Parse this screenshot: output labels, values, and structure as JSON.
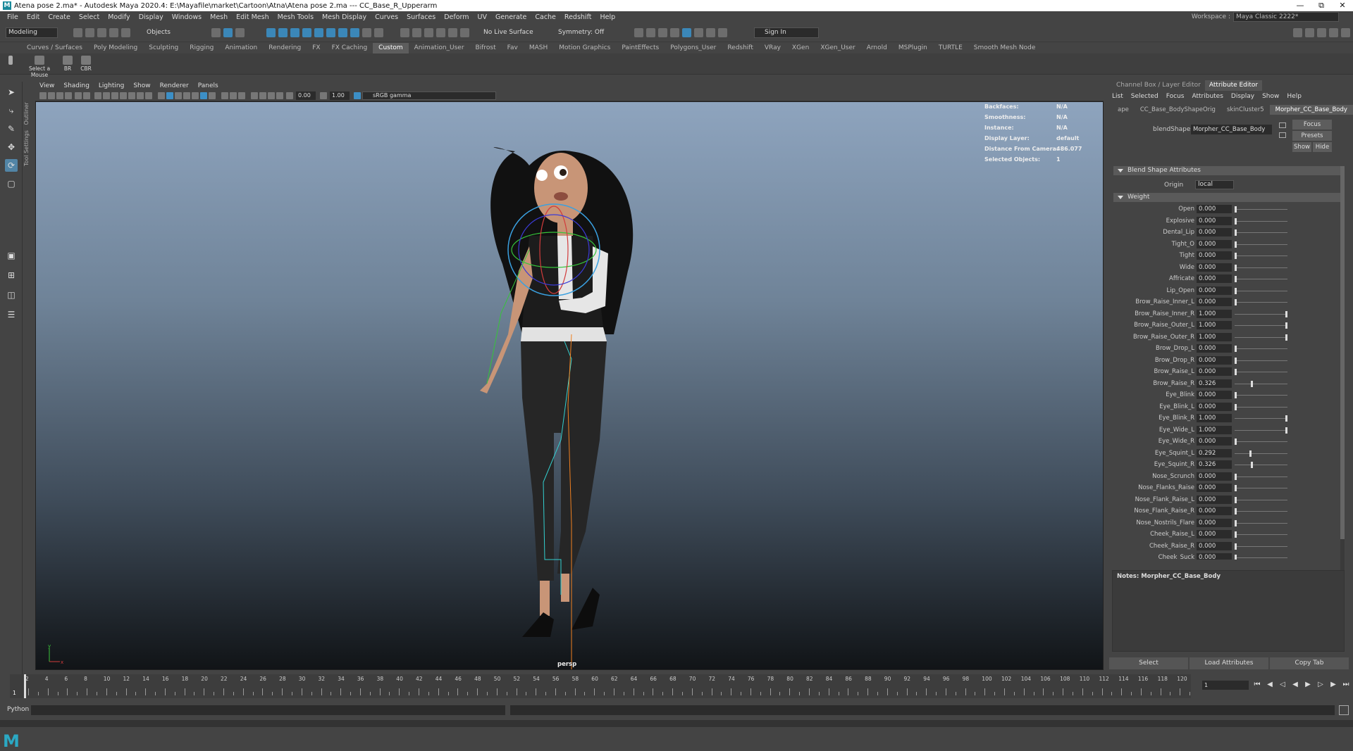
{
  "title": {
    "text": "Atena pose 2.ma* - Autodesk Maya 2020.4: E:\\Mayafile\\market\\Cartoon\\Atna\\Atena pose 2.ma  ---  CC_Base_R_Upperarm",
    "logo": "M"
  },
  "menu": [
    "File",
    "Edit",
    "Create",
    "Select",
    "Modify",
    "Display",
    "Windows",
    "Mesh",
    "Edit Mesh",
    "Mesh Tools",
    "Mesh Display",
    "Curves",
    "Surfaces",
    "Deform",
    "UV",
    "Generate",
    "Cache",
    "Redshift",
    "Help"
  ],
  "workspace": {
    "label": "Workspace :",
    "value": "Maya Classic 2222*"
  },
  "status": {
    "mode": "Modeling",
    "objects": "Objects",
    "live_surface": "No Live Surface",
    "symmetry": "Symmetry: Off",
    "sign_in": "Sign In"
  },
  "shelf_tabs": [
    "Curves / Surfaces",
    "Poly Modeling",
    "Sculpting",
    "Rigging",
    "Animation",
    "Rendering",
    "FX",
    "FX Caching",
    "Custom",
    "Animation_User",
    "Bifrost",
    "Fav",
    "MASH",
    "Motion Graphics",
    "PaintEffects",
    "Polygons_User",
    "Redshift",
    "VRay",
    "XGen",
    "XGen_User",
    "Arnold",
    "MSPlugin",
    "TURTLE",
    "Smooth Mesh Node"
  ],
  "shelf_active": "Custom",
  "shelf_buttons": [
    "Select a Mouse",
    "BR",
    "CBR"
  ],
  "side_labels": {
    "tool_settings": "Tool Settings",
    "outliner": "Outliner"
  },
  "panel_menu": [
    "View",
    "Shading",
    "Lighting",
    "Show",
    "Renderer",
    "Panels"
  ],
  "panel_toolbar": {
    "exposure": "0.00",
    "gamma": "1.00",
    "color_space": "sRGB gamma"
  },
  "hud": [
    {
      "k": "Backfaces:",
      "v": "N/A"
    },
    {
      "k": "Smoothness:",
      "v": "N/A"
    },
    {
      "k": "Instance:",
      "v": "N/A"
    },
    {
      "k": "Display Layer:",
      "v": "default"
    },
    {
      "k": "Distance From Camera:",
      "v": "486.077"
    },
    {
      "k": "Selected Objects:",
      "v": "1"
    }
  ],
  "camera": "persp",
  "right_tabs": [
    "Channel Box / Layer Editor",
    "Attribute Editor"
  ],
  "right_menu": [
    "List",
    "Selected",
    "Focus",
    "Attributes",
    "Display",
    "Show",
    "Help"
  ],
  "node_tabs": [
    "ape",
    "CC_Base_BodyShapeOrig",
    "skinCluster5",
    "Morpher_CC_Base_Body"
  ],
  "blendshape": {
    "label": "blendShape:",
    "value": "Morpher_CC_Base_Body"
  },
  "rbuttons": {
    "focus": "Focus",
    "presets": "Presets",
    "show": "Show",
    "hide": "Hide"
  },
  "sections": {
    "blend": "Blend Shape Attributes",
    "weight": "Weight"
  },
  "origin": {
    "label": "Origin",
    "value": "local"
  },
  "weights": [
    {
      "name": "Open",
      "value": "0.000",
      "v": 0
    },
    {
      "name": "Explosive",
      "value": "0.000",
      "v": 0
    },
    {
      "name": "Dental_Lip",
      "value": "0.000",
      "v": 0
    },
    {
      "name": "Tight_O",
      "value": "0.000",
      "v": 0
    },
    {
      "name": "Tight",
      "value": "0.000",
      "v": 0
    },
    {
      "name": "Wide",
      "value": "0.000",
      "v": 0
    },
    {
      "name": "Affricate",
      "value": "0.000",
      "v": 0
    },
    {
      "name": "Lip_Open",
      "value": "0.000",
      "v": 0
    },
    {
      "name": "Brow_Raise_Inner_L",
      "value": "0.000",
      "v": 0
    },
    {
      "name": "Brow_Raise_Inner_R",
      "value": "1.000",
      "v": 1
    },
    {
      "name": "Brow_Raise_Outer_L",
      "value": "1.000",
      "v": 1
    },
    {
      "name": "Brow_Raise_Outer_R",
      "value": "1.000",
      "v": 1
    },
    {
      "name": "Brow_Drop_L",
      "value": "0.000",
      "v": 0
    },
    {
      "name": "Brow_Drop_R",
      "value": "0.000",
      "v": 0
    },
    {
      "name": "Brow_Raise_L",
      "value": "0.000",
      "v": 0
    },
    {
      "name": "Brow_Raise_R",
      "value": "0.326",
      "v": 0.326
    },
    {
      "name": "Eye_Blink",
      "value": "0.000",
      "v": 0
    },
    {
      "name": "Eye_Blink_L",
      "value": "0.000",
      "v": 0
    },
    {
      "name": "Eye_Blink_R",
      "value": "1.000",
      "v": 1
    },
    {
      "name": "Eye_Wide_L",
      "value": "1.000",
      "v": 1
    },
    {
      "name": "Eye_Wide_R",
      "value": "0.000",
      "v": 0
    },
    {
      "name": "Eye_Squint_L",
      "value": "0.292",
      "v": 0.292
    },
    {
      "name": "Eye_Squint_R",
      "value": "0.326",
      "v": 0.326
    },
    {
      "name": "Nose_Scrunch",
      "value": "0.000",
      "v": 0
    },
    {
      "name": "Nose_Flanks_Raise",
      "value": "0.000",
      "v": 0
    },
    {
      "name": "Nose_Flank_Raise_L",
      "value": "0.000",
      "v": 0
    },
    {
      "name": "Nose_Flank_Raise_R",
      "value": "0.000",
      "v": 0
    },
    {
      "name": "Nose_Nostrils_Flare",
      "value": "0.000",
      "v": 0
    },
    {
      "name": "Cheek_Raise_L",
      "value": "0.000",
      "v": 0
    },
    {
      "name": "Cheek_Raise_R",
      "value": "0.000",
      "v": 0
    },
    {
      "name": "Cheek_Suck",
      "value": "0.000",
      "v": 0
    }
  ],
  "notes": "Notes: Morpher_CC_Base_Body",
  "bottom_buttons": [
    "Select",
    "Load Attributes",
    "Copy Tab"
  ],
  "timeline": {
    "labels": [
      "2",
      "4",
      "6",
      "8",
      "10",
      "12",
      "14",
      "16",
      "18",
      "20",
      "22",
      "24",
      "26",
      "28",
      "30",
      "32",
      "34",
      "36",
      "38",
      "40",
      "42",
      "44",
      "46",
      "48",
      "50",
      "52",
      "54",
      "56",
      "58",
      "60",
      "62",
      "64",
      "66",
      "68",
      "70",
      "72",
      "74",
      "76",
      "78",
      "80",
      "82",
      "84",
      "86",
      "88",
      "90",
      "92",
      "94",
      "96",
      "98",
      "100",
      "102",
      "104",
      "106",
      "108",
      "110",
      "112",
      "114",
      "116",
      "118",
      "120"
    ],
    "current": "1",
    "frame_field": "1"
  },
  "cmd": {
    "label": "Python"
  },
  "colors": {
    "accent": "#5285a6",
    "viewport_top": "#8ea4be",
    "viewport_bottom": "#111417"
  }
}
